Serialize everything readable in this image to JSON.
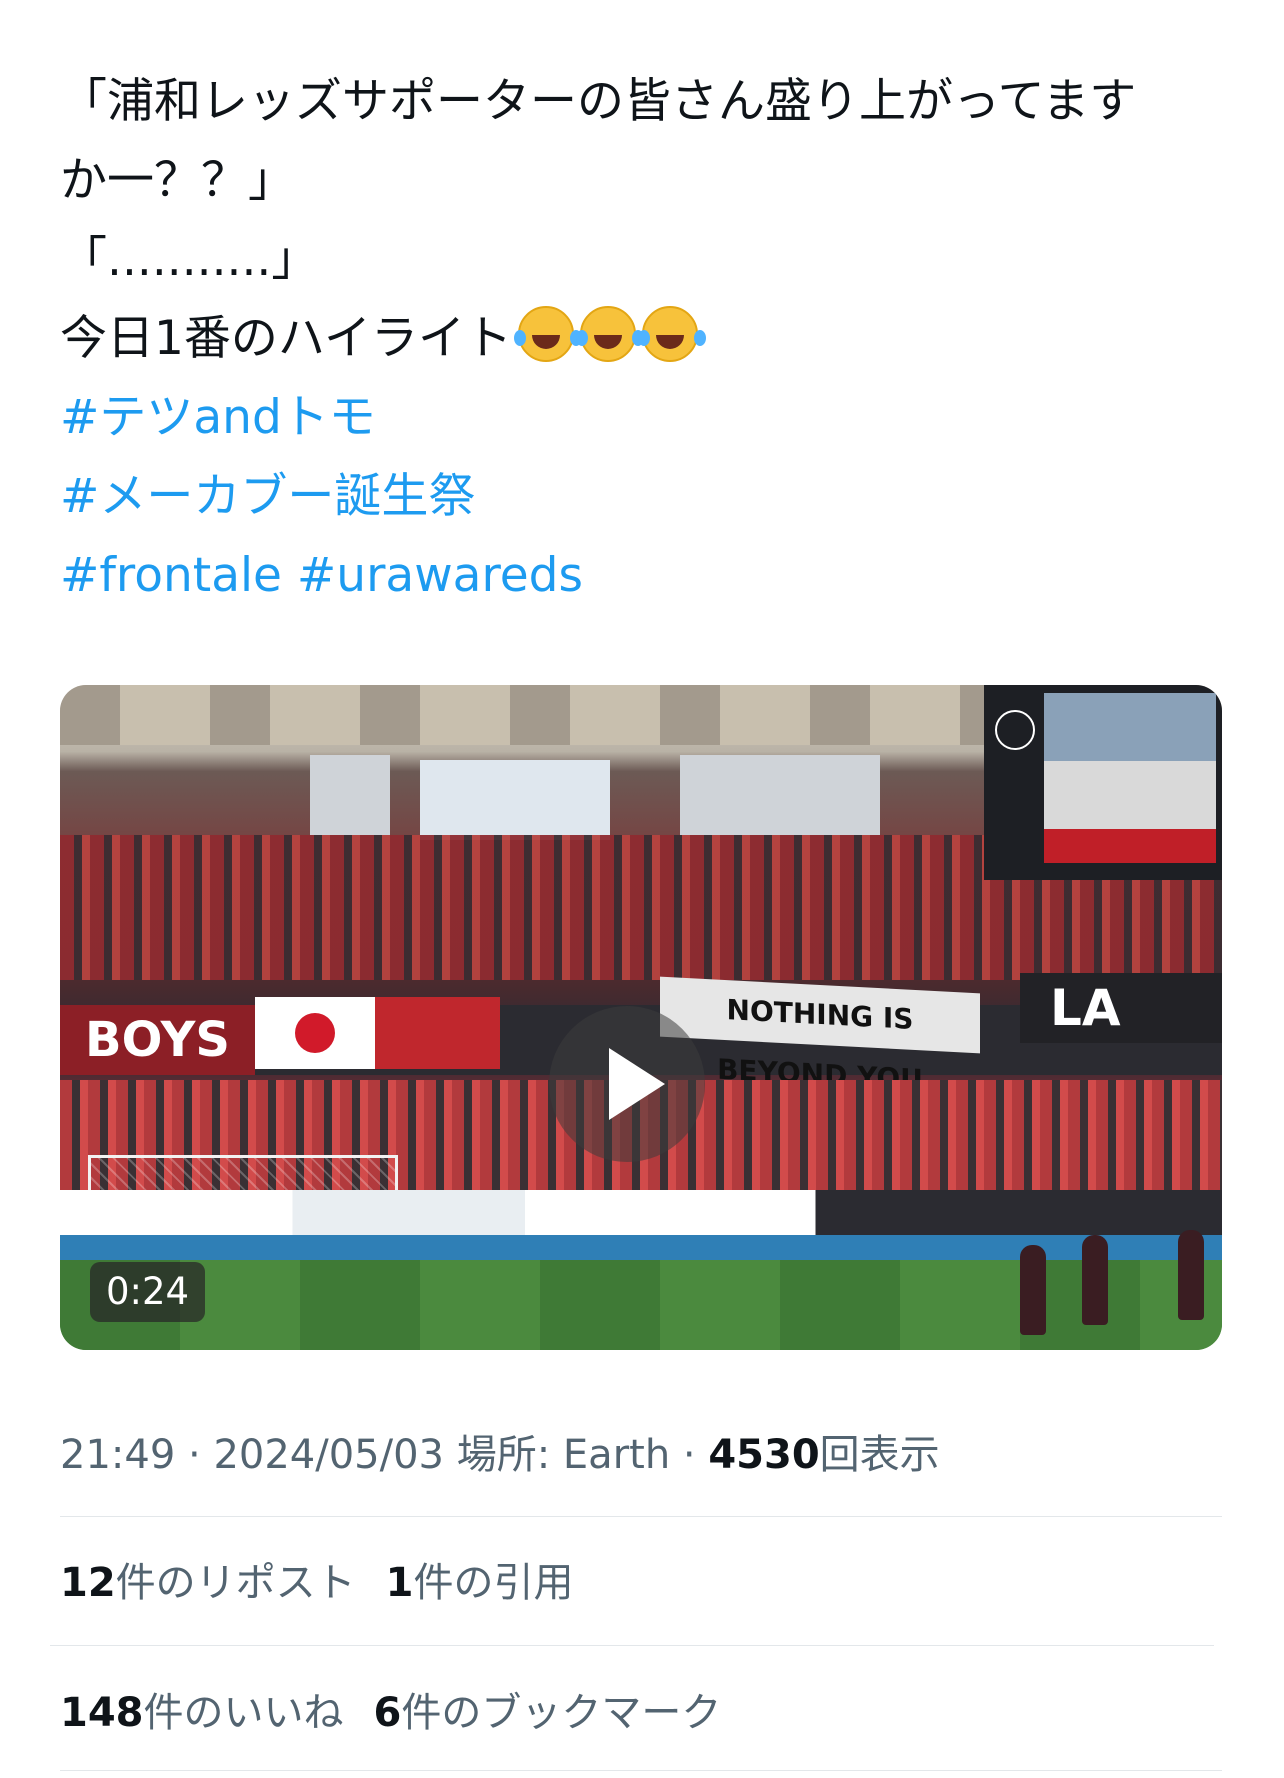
{
  "tweet": {
    "lines": [
      "「浦和レッズサポーターの皆さん盛り上がってます",
      "か一？？」",
      "「...........」",
      "今日1番のハイライト"
    ],
    "emoji_name": "face-with-tears-of-joy",
    "hashtags": {
      "tag1": "#テツandトモ",
      "tag2": "#メーカブー誕生祭",
      "tag3": "#frontale",
      "tag4": "#urawareds"
    }
  },
  "video": {
    "duration": "0:24",
    "banner_boys": "BOYS",
    "banner_beyond": "NOTHING IS BEYOND YOU",
    "banner_la": "LA"
  },
  "meta": {
    "time": "21:49",
    "separator1": "·",
    "date": "2024/05/03",
    "location_label": "場所:",
    "location": "Earth",
    "separator2": "·",
    "views_count": "4530",
    "views_label": "回表示"
  },
  "stats": {
    "reposts_count": "12",
    "reposts_label": "件のリポスト",
    "quotes_count": "1",
    "quotes_label": "件の引用",
    "likes_count": "148",
    "likes_label": "件のいいね",
    "bookmarks_count": "6",
    "bookmarks_label": "件のブックマーク"
  },
  "colors": {
    "hashtag": "#1d9bf0",
    "text": "#0f1419",
    "secondary": "#536471",
    "divider": "#e3e7ea"
  }
}
